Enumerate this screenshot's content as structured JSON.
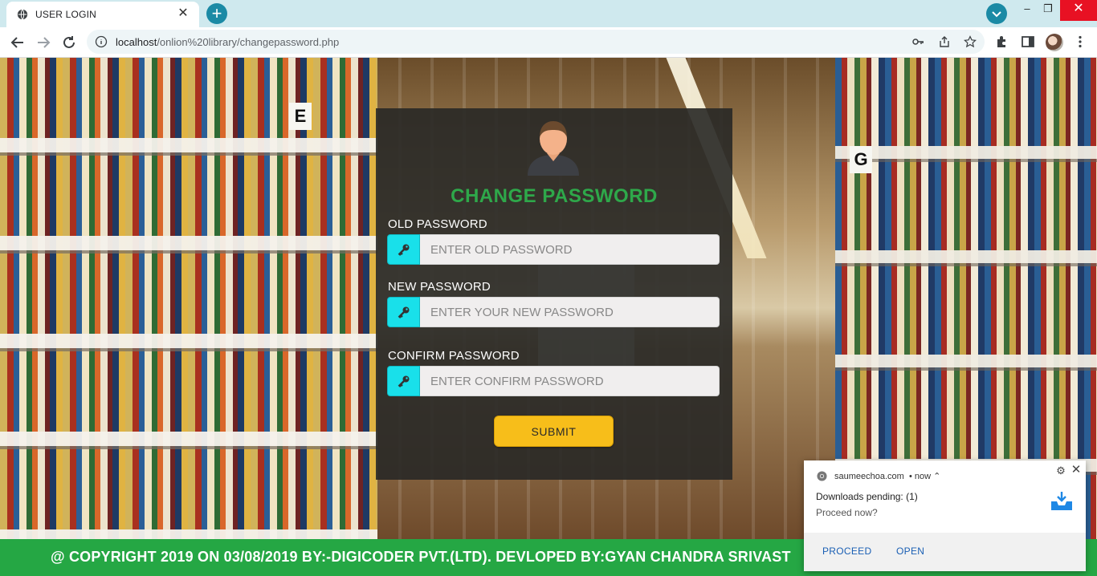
{
  "browser": {
    "tab_title": "USER LOGIN",
    "url_host": "localhost",
    "url_path": "/onlion%20library/changepassword.php",
    "window_controls": {
      "minimize": "–",
      "restore": "❐",
      "close": "✕"
    }
  },
  "form": {
    "title": "CHANGE PASSWORD",
    "old_label": "OLD PASSWORD",
    "old_placeholder": "ENTER OLD PASSWORD",
    "new_label": "NEW PASSWORD",
    "new_placeholder": "ENTER YOUR NEW PASSWORD",
    "confirm_label": "CONFIRM PASSWORD",
    "confirm_placeholder": "ENTER CONFIRM PASSWORD",
    "submit_label": "SUBMIT",
    "title_color": "#2ea84a",
    "key_box_color": "#19e0ea",
    "submit_color": "#f7be1a"
  },
  "background": {
    "signs": [
      "E",
      "G"
    ]
  },
  "footer": {
    "text": "@ COPYRIGHT 2019 ON 03/08/2019 BY:-DIGICODER PVT.(LTD). DEVLOPED BY:GYAN CHANDRA SRIVAST",
    "color": "#25a744"
  },
  "notification": {
    "source": "saumeechoa.com",
    "time": "• now ⌃",
    "message": "Downloads pending: (1)",
    "sub": "Proceed now?",
    "proceed_label": "PROCEED",
    "open_label": "OPEN"
  }
}
